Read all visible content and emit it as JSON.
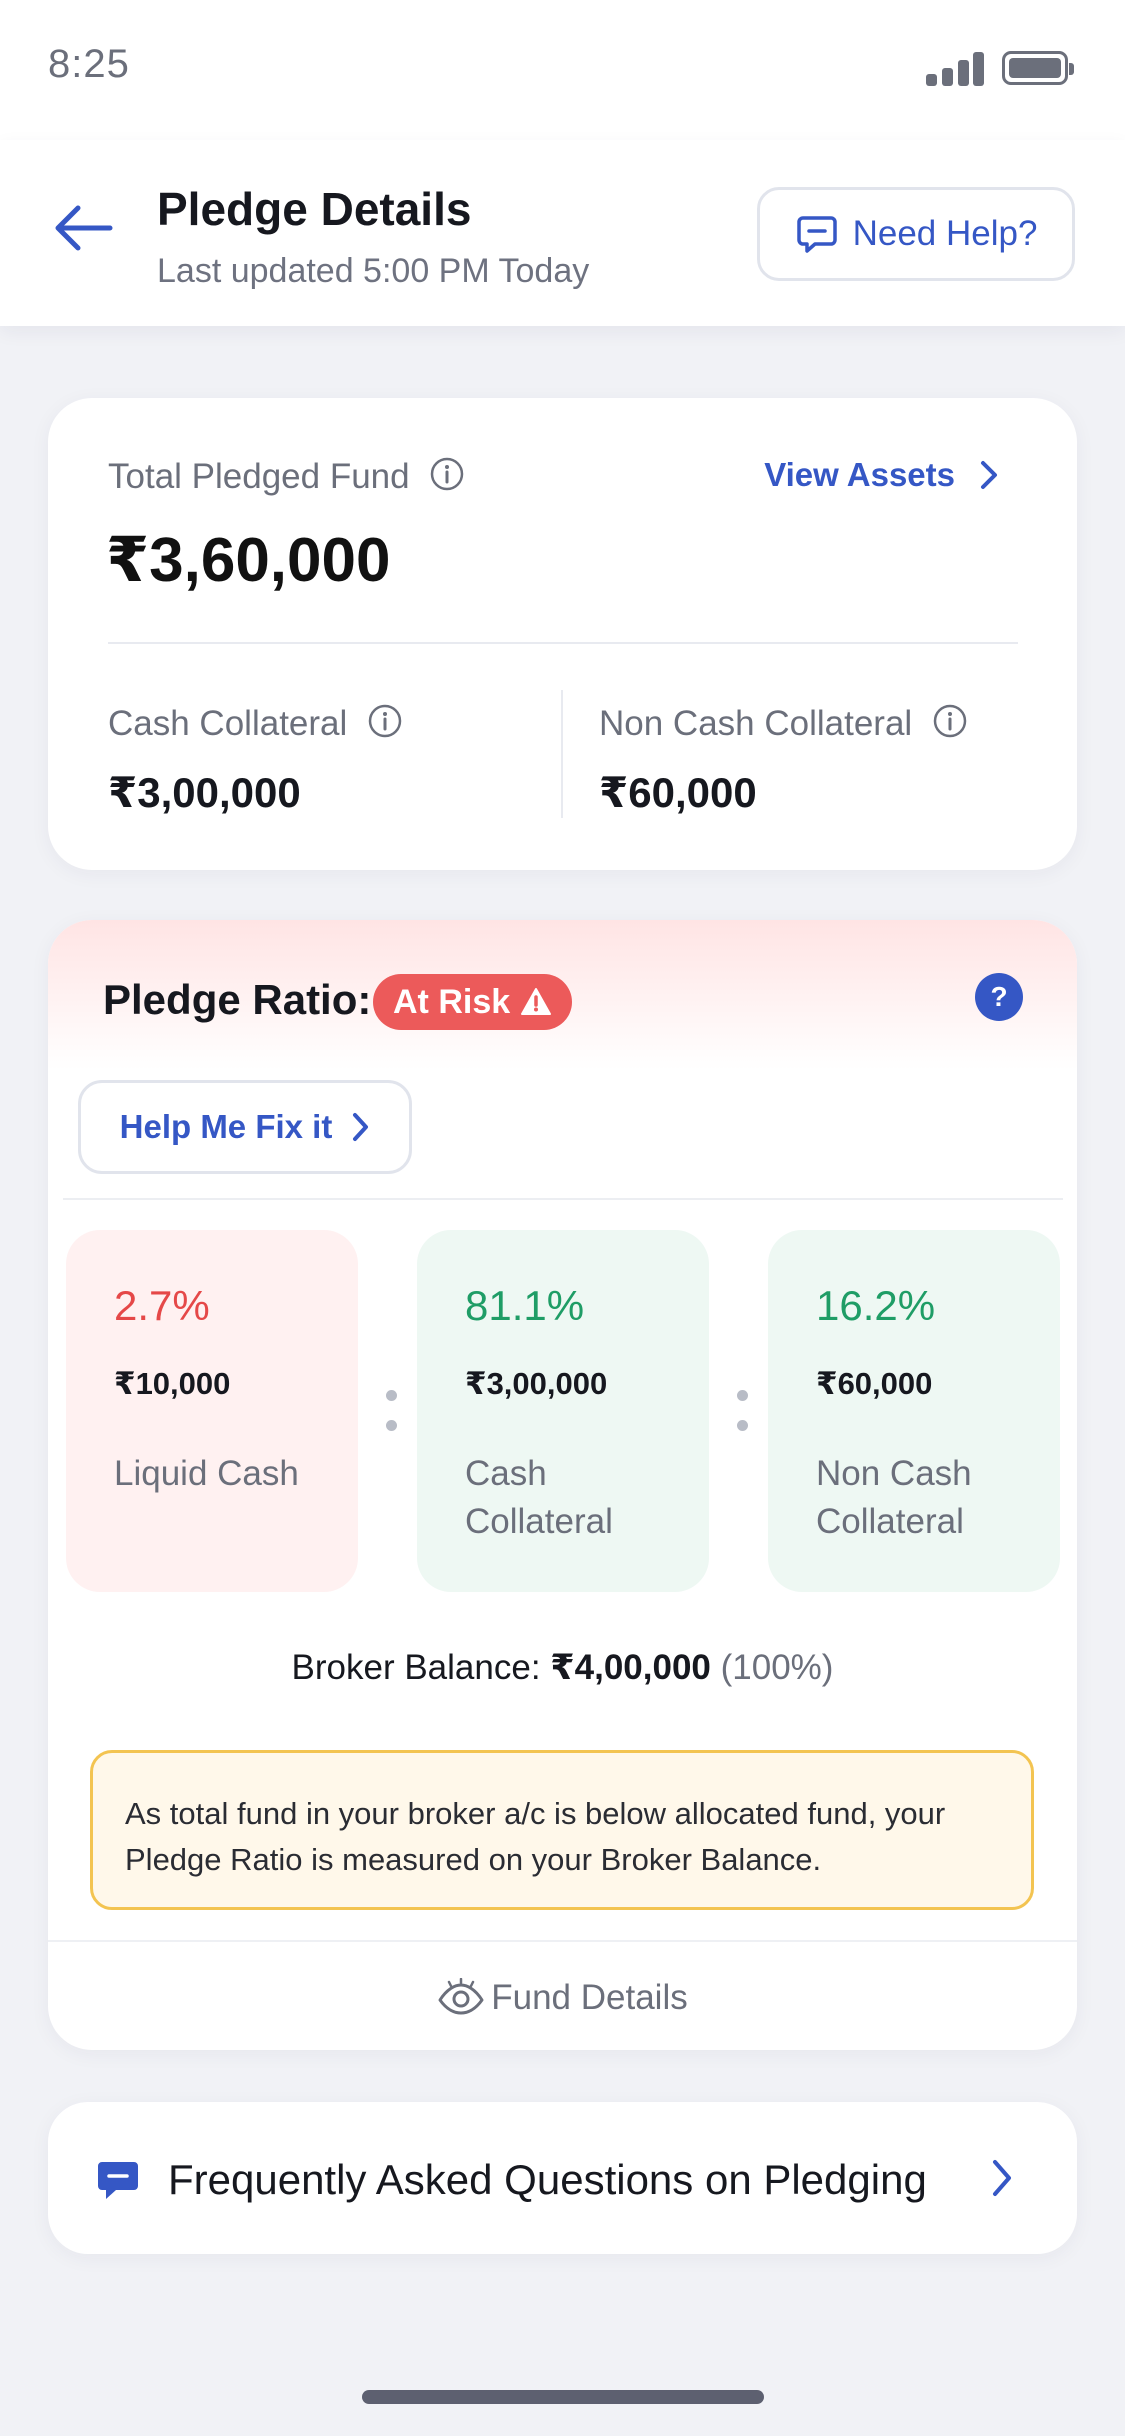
{
  "status_bar": {
    "time": "8:25"
  },
  "header": {
    "title": "Pledge Details",
    "subtitle": "Last updated 5:00 PM Today",
    "help_label": "Need Help?"
  },
  "total_card": {
    "label": "Total Pledged Fund",
    "value": "₹3,60,000",
    "view_assets": "View Assets",
    "cash_collateral_label": "Cash Collateral",
    "cash_collateral_value": "₹3,00,000",
    "non_cash_collateral_label": "Non Cash Collateral",
    "non_cash_collateral_value": "₹60,000"
  },
  "ratio_card": {
    "title": "Pledge Ratio:",
    "status": "At Risk",
    "fix_label": "Help Me Fix it",
    "tiles": [
      {
        "pct": "2.7%",
        "amount": "₹10,000",
        "name": "Liquid Cash"
      },
      {
        "pct": "81.1%",
        "amount": "₹3,00,000",
        "name": "Cash Collateral"
      },
      {
        "pct": "16.2%",
        "amount": "₹60,000",
        "name": "Non Cash Collateral"
      }
    ],
    "broker_label": "Broker Balance:",
    "broker_value": "₹4,00,000",
    "broker_pct": "(100%)",
    "note": "As total fund in your broker a/c is below allocated fund, your Pledge Ratio is measured on your Broker Balance.",
    "fund_details": "Fund Details"
  },
  "faq": {
    "label": "Frequently Asked Questions on Pledging"
  },
  "colors": {
    "accent": "#3557c5",
    "risk": "#ec5a5a",
    "positive": "#1f9d66",
    "negative": "#e54848",
    "note_border": "#f3c451"
  },
  "icons": [
    "back-arrow-icon",
    "chat-help-icon",
    "info-icon",
    "chevron-right-icon",
    "warning-icon",
    "question-icon",
    "eye-icon",
    "faq-chat-icon"
  ]
}
